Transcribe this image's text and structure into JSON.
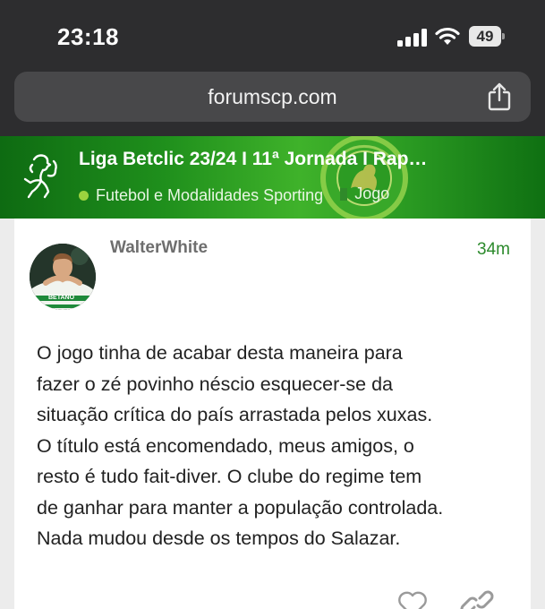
{
  "status_bar": {
    "time": "23:18",
    "battery": "49",
    "icons": [
      "signal-icon",
      "wifi-icon",
      "battery-icon"
    ]
  },
  "browser": {
    "url": "forumscp.com",
    "share_icon": "share-icon"
  },
  "topic": {
    "title": "Liga Betclic 23/24 I 11ª Jornada I Rap…",
    "breadcrumbs": [
      {
        "label": "Futebol e Modalidades Sporting",
        "marker": "dot",
        "color": "#9bd33f"
      },
      {
        "label": "Jogo",
        "marker": "square",
        "color": "#2f8a2a"
      }
    ],
    "logo_icon": "lion-icon",
    "background_crest": "sporting-crest"
  },
  "post": {
    "username": "WalterWhite",
    "time": "34m",
    "body_lines": [
      "O jogo tinha de acabar desta maneira para",
      "fazer o zé povinho néscio esquecer-se da",
      "situação crítica do país arrastada pelos xuxas.",
      "O título está encomendado, meus amigos, o",
      "resto é tudo fait-diver. O clube do regime tem",
      "de ganhar para manter a população controlada.",
      "Nada mudou desde os tempos do Salazar."
    ],
    "actions": [
      "heart-icon",
      "link-icon"
    ]
  },
  "colors": {
    "header_green": "#1f8f1c",
    "accent_green": "#2c8a2c",
    "chrome_dark": "#2d2d2f"
  }
}
